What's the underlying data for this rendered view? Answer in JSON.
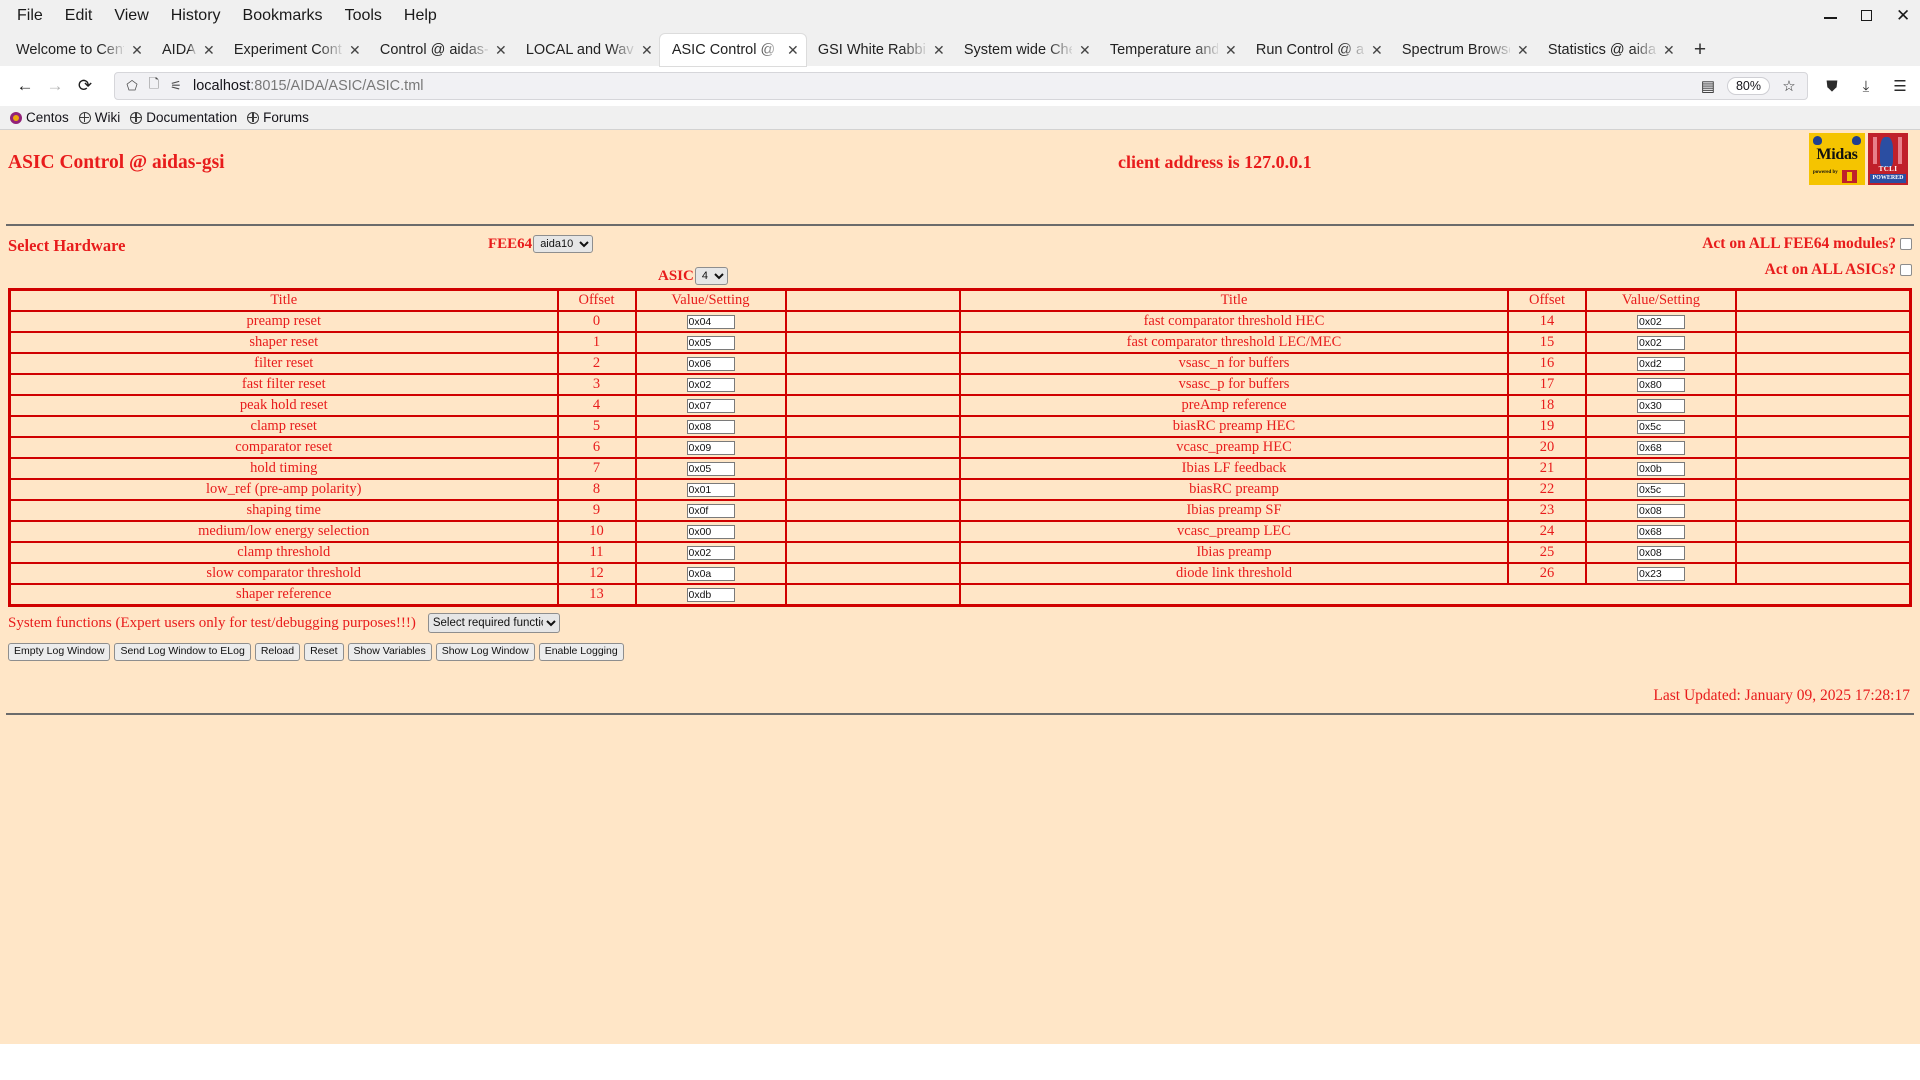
{
  "browser": {
    "menus": [
      "File",
      "Edit",
      "View",
      "History",
      "Bookmarks",
      "Tools",
      "Help"
    ],
    "window_controls": {
      "minimize": "minimize-icon",
      "maximize": "maximize-icon",
      "close": "✕"
    },
    "tabs": [
      {
        "title": "Welcome to CentO",
        "active": false
      },
      {
        "title": "AIDA",
        "active": false
      },
      {
        "title": "Experiment Contro",
        "active": false
      },
      {
        "title": "Control @ aidas-gs",
        "active": false
      },
      {
        "title": "LOCAL and Wavefo",
        "active": false
      },
      {
        "title": "ASIC Control @ aid",
        "active": true
      },
      {
        "title": "GSI White Rabbit T",
        "active": false
      },
      {
        "title": "System wide Check",
        "active": false
      },
      {
        "title": "Temperature and s",
        "active": false
      },
      {
        "title": "Run Control @ aida",
        "active": false
      },
      {
        "title": "Spectrum Browser",
        "active": false
      },
      {
        "title": "Statistics @ aidas-",
        "active": false
      }
    ],
    "new_tab_label": "+",
    "nav": {
      "back": "←",
      "forward": "→",
      "reload": "⟳"
    },
    "url": {
      "host": "localhost",
      "path": ":8015/AIDA/ASIC/ASIC.tml"
    },
    "zoom_level": "80%",
    "bookmarks": [
      {
        "label": "Centos",
        "icon": "centos-icon"
      },
      {
        "label": "Wiki",
        "icon": "globe-icon"
      },
      {
        "label": "Documentation",
        "icon": "globe-icon"
      },
      {
        "label": "Forums",
        "icon": "globe-icon"
      }
    ]
  },
  "page": {
    "title": "ASIC Control @ aidas-gsi",
    "client_address": "client address is 127.0.0.1",
    "logos": {
      "midas": {
        "word": "Midas",
        "sub": "powered by"
      },
      "triumf": {
        "word": "TCLI",
        "band": "POWERED"
      }
    },
    "hardware": {
      "heading": "Select Hardware",
      "fee64_label": "FEE64",
      "fee64_value": "aida10",
      "fee64_options": [
        "aida10"
      ],
      "asic_label": "ASIC",
      "asic_value": "4",
      "asic_options": [
        "4"
      ],
      "act_all_fee64_label": "Act on ALL FEE64 modules?",
      "act_all_fee64_checked": false,
      "act_all_asics_label": "Act on ALL ASICs?",
      "act_all_asics_checked": false
    },
    "table": {
      "headers": [
        "Title",
        "Offset",
        "Value/Setting"
      ],
      "left_rows": [
        {
          "title": "preamp reset",
          "offset": "0",
          "value": "0x04"
        },
        {
          "title": "shaper reset",
          "offset": "1",
          "value": "0x05"
        },
        {
          "title": "filter reset",
          "offset": "2",
          "value": "0x06"
        },
        {
          "title": "fast filter reset",
          "offset": "3",
          "value": "0x02"
        },
        {
          "title": "peak hold reset",
          "offset": "4",
          "value": "0x07"
        },
        {
          "title": "clamp reset",
          "offset": "5",
          "value": "0x08"
        },
        {
          "title": "comparator reset",
          "offset": "6",
          "value": "0x09"
        },
        {
          "title": "hold timing",
          "offset": "7",
          "value": "0x05"
        },
        {
          "title": "low_ref (pre-amp polarity)",
          "offset": "8",
          "value": "0x01"
        },
        {
          "title": "shaping time",
          "offset": "9",
          "value": "0x0f"
        },
        {
          "title": "medium/low energy selection",
          "offset": "10",
          "value": "0x00"
        },
        {
          "title": "clamp threshold",
          "offset": "11",
          "value": "0x02"
        },
        {
          "title": "slow comparator threshold",
          "offset": "12",
          "value": "0x0a"
        },
        {
          "title": "shaper reference",
          "offset": "13",
          "value": "0xdb"
        }
      ],
      "right_rows": [
        {
          "title": "fast comparator threshold HEC",
          "offset": "14",
          "value": "0x02"
        },
        {
          "title": "fast comparator threshold LEC/MEC",
          "offset": "15",
          "value": "0x02"
        },
        {
          "title": "vsasc_n for buffers",
          "offset": "16",
          "value": "0xd2"
        },
        {
          "title": "vsasc_p for buffers",
          "offset": "17",
          "value": "0x80"
        },
        {
          "title": "preAmp reference",
          "offset": "18",
          "value": "0x30"
        },
        {
          "title": "biasRC preamp HEC",
          "offset": "19",
          "value": "0x5c"
        },
        {
          "title": "vcasc_preamp HEC",
          "offset": "20",
          "value": "0x68"
        },
        {
          "title": "Ibias LF feedback",
          "offset": "21",
          "value": "0x0b"
        },
        {
          "title": "biasRC preamp",
          "offset": "22",
          "value": "0x5c"
        },
        {
          "title": "Ibias preamp SF",
          "offset": "23",
          "value": "0x08"
        },
        {
          "title": "vcasc_preamp LEC",
          "offset": "24",
          "value": "0x68"
        },
        {
          "title": "Ibias preamp",
          "offset": "25",
          "value": "0x08"
        },
        {
          "title": "diode link threshold",
          "offset": "26",
          "value": "0x23"
        },
        {
          "title": "",
          "offset": "",
          "value": ""
        }
      ]
    },
    "footer": {
      "system_functions_text": "System functions (Expert users only for test/debugging purposes!!!)",
      "function_select_value": "Select required function",
      "function_select_options": [
        "Select required function"
      ],
      "buttons": [
        "Empty Log Window",
        "Send Log Window to ELog",
        "Reload",
        "Reset",
        "Show Variables",
        "Show Log Window",
        "Enable Logging"
      ],
      "last_updated": "Last Updated: January 09, 2025 17:28:17"
    }
  },
  "colors": {
    "page_bg": "#ffe6c7",
    "accent_red": "#e81c1c",
    "border_red": "#d00000",
    "rule_gray": "#6b6b6b"
  }
}
